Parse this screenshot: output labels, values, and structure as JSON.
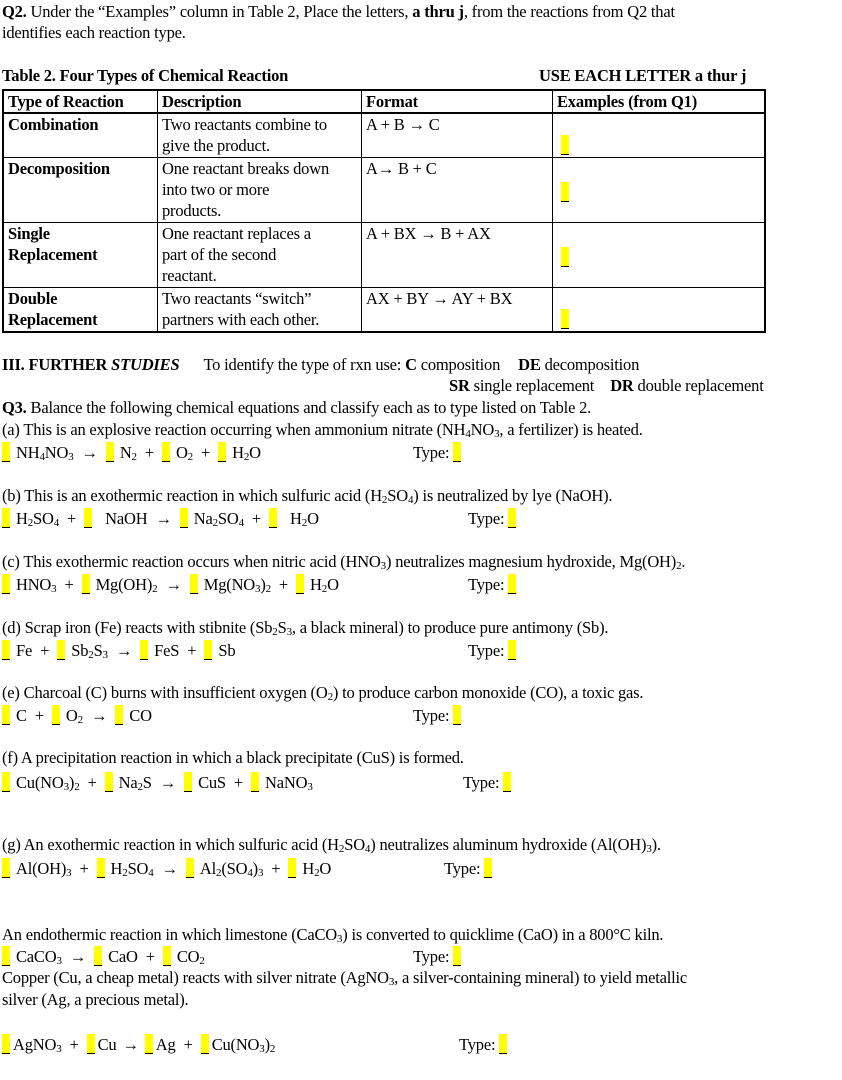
{
  "q2": {
    "label": "Q2.",
    "text_1": " Under the “Examples” column in Table 2, Place the letters, ",
    "bold": "a thru j",
    "text_2": ", from the reactions from Q2 that",
    "line2": "identifies each reaction type."
  },
  "table": {
    "title": "Table 2. Four Types of Chemical Reaction",
    "note": "USE EACH LETTER a thur j",
    "headers": [
      "Type of Reaction",
      "Description",
      "Format",
      "Examples (from Q1)"
    ],
    "rows": [
      {
        "type_1": "Combination",
        "type_2": "",
        "desc": [
          "Two reactants combine to",
          "give the product.",
          ""
        ],
        "format": "A + B → C",
        "example": ""
      },
      {
        "type_1": "Decomposition",
        "type_2": "",
        "desc": [
          "One reactant breaks down",
          "into two or more",
          "products."
        ],
        "format": "A→ B + C",
        "example": ""
      },
      {
        "type_1": "Single",
        "type_2": "Replacement",
        "desc": [
          "One reactant replaces a",
          "part of the second",
          "reactant."
        ],
        "format": "A + BX → B + AX",
        "example": ""
      },
      {
        "type_1": "Double",
        "type_2": "Replacement",
        "desc": [
          "Two reactants “switch”",
          "partners with each other.",
          ""
        ],
        "format": "AX + BY → AY + BX",
        "example": ""
      }
    ]
  },
  "further": {
    "heading_1": "III. FURTHER ",
    "heading_2": "STUDIES",
    "intro": "To identify the type of rxn use: ",
    "codes": [
      {
        "code": "C",
        "meaning": " composition"
      },
      {
        "code": "DE",
        "meaning": " decomposition"
      },
      {
        "code": "SR",
        "meaning": " single replacement"
      },
      {
        "code": "DR",
        "meaning": " double replacement"
      }
    ]
  },
  "q3": {
    "label": "Q3.",
    "text": " Balance the following chemical equations and classify each as to type listed on Table 2."
  },
  "type_label": "Type:",
  "reactions": {
    "a": {
      "desc": "(a) This is an explosive reaction occurring when ammonium nitrate (NH4NO3, a fertilizer) is heated."
    },
    "b": {
      "desc": "(b) This is an exothermic reaction in which sulfuric acid (H2SO4) is neutralized by lye (NaOH)."
    },
    "c": {
      "desc": "(c) This exothermic reaction occurs when nitric acid (HNO3) neutralizes magnesium hydroxide, Mg(OH)2."
    },
    "d": {
      "desc": "(d) Scrap iron (Fe) reacts with stibnite (Sb2S3, a black mineral) to produce pure antimony (Sb)."
    },
    "e": {
      "desc": "(e) Charcoal (C) burns with insufficient oxygen (O2) to produce carbon monoxide (CO), a toxic gas."
    },
    "f": {
      "desc": "(f)  A precipitation reaction in which a black precipitate (CuS) is formed."
    },
    "g": {
      "desc": "(g) An exothermic reaction in which sulfuric acid (H2SO4) neutralizes aluminum hydroxide (Al(OH)3)."
    },
    "h": {
      "desc": "An endothermic reaction in which limestone (CaCO3) is converted to quicklime (CaO) in a 800°C kiln."
    },
    "i": {
      "desc_1": "Copper (Cu, a cheap metal) reacts with silver nitrate (AgNO3, a silver-containing mineral) to yield metallic",
      "desc_2": "silver (Ag, a precious metal)."
    }
  },
  "terms": {
    "plus": "+",
    "arrow": "→"
  },
  "species": {
    "a": [
      "NH4NO3",
      "N2",
      "O2",
      "H2O"
    ],
    "b": [
      "H2SO4",
      "NaOH",
      "Na2SO4",
      "H2O"
    ],
    "c": [
      "HNO3",
      "Mg(OH)2",
      "Mg(NO3)2",
      "H2O"
    ],
    "d": [
      "Fe",
      "Sb2S3",
      "FeS",
      "Sb"
    ],
    "e": [
      "C",
      "O2",
      "CO"
    ],
    "f": [
      "Cu(NO3)2",
      "Na2S",
      "CuS",
      "NaNO3"
    ],
    "g": [
      "Al(OH)3",
      "H2SO4",
      "Al2(SO4)3",
      "H2O"
    ],
    "h": [
      "CaCO3",
      "CaO",
      "CO2"
    ],
    "i": [
      "AgNO3",
      "Cu",
      "Ag",
      "Cu(NO3)2"
    ]
  },
  "colors": {
    "answer_highlight": "#ffff00"
  }
}
